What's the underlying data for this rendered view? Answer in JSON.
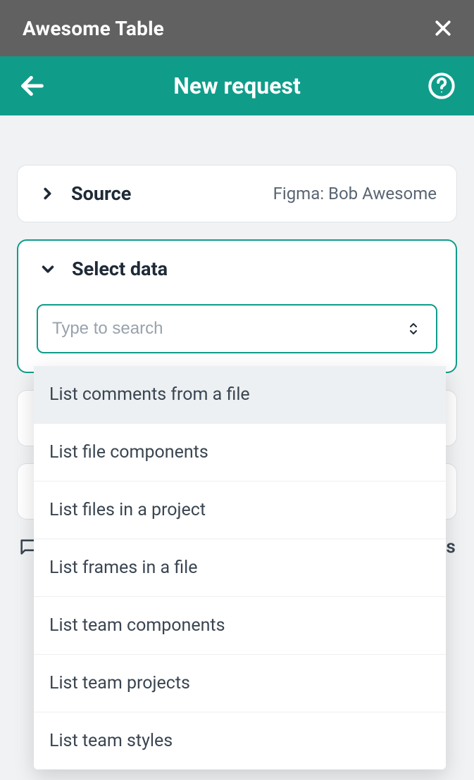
{
  "titlebar": {
    "title": "Awesome Table"
  },
  "topbar": {
    "title": "New request"
  },
  "source_card": {
    "label": "Source",
    "value": "Figma: Bob Awesome"
  },
  "select_data_card": {
    "label": "Select data",
    "search_placeholder": "Type to search"
  },
  "dropdown": {
    "items": [
      "List comments from a file",
      "List file components",
      "List files in a project",
      "List frames in a file",
      "List team components",
      "List team projects",
      "List team styles"
    ]
  },
  "obscured_right_text": "gs"
}
